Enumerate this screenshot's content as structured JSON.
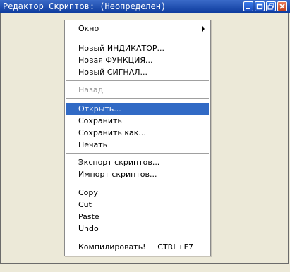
{
  "window": {
    "title": "Редактор Скриптов:  (Неопределен)",
    "buttons": [
      "minimize-icon",
      "maximize-icon",
      "close-icon"
    ]
  },
  "menu": {
    "items": [
      {
        "label": "Окно",
        "has_submenu": true
      },
      {
        "label": "Новый ИНДИКАТОР..."
      },
      {
        "label": "Новая ФУНКЦИЯ..."
      },
      {
        "label": "Новый СИГНАЛ..."
      },
      {
        "label": "Назад",
        "disabled": true
      },
      {
        "label": "Открыть...",
        "highlighted": true
      },
      {
        "label": "Сохранить"
      },
      {
        "label": "Сохранить как..."
      },
      {
        "label": "Печать"
      },
      {
        "label": "Экспорт скриптов..."
      },
      {
        "label": "Импорт скриптов..."
      },
      {
        "label": "Copy"
      },
      {
        "label": "Cut"
      },
      {
        "label": "Paste"
      },
      {
        "label": "Undo"
      },
      {
        "label": "Компилировать!",
        "shortcut": "CTRL+F7"
      }
    ]
  },
  "colors": {
    "titlebar": "#0c3a9c",
    "highlight": "#316ac5",
    "background": "#ece9d8"
  }
}
